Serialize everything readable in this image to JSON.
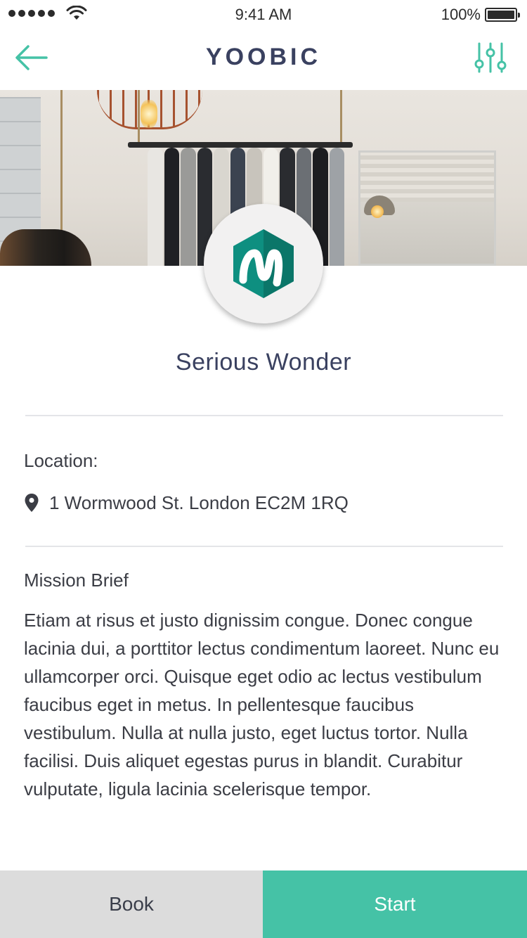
{
  "status_bar": {
    "time": "9:41 AM",
    "battery_percent": "100%",
    "signal_bars": 5
  },
  "nav": {
    "title": "YOOBIC",
    "back_icon": "arrow-left-icon",
    "filter_icon": "sliders-icon",
    "accent_color": "#45c2a6"
  },
  "store": {
    "name": "Serious Wonder",
    "logo_icon": "yoobic-m-logo"
  },
  "location": {
    "label": "Location:",
    "address": "1 Wormwood St. London EC2M 1RQ",
    "icon": "map-pin-icon"
  },
  "mission": {
    "label": "Mission Brief",
    "body": "Etiam at risus et justo dignissim congue. Donec congue lacinia dui, a porttitor lectus condimentum laoreet. Nunc eu ullamcorper orci. Quisque eget odio ac lectus vestibulum faucibus eget in metus. In pellentesque faucibus vestibulum. Nulla at nulla justo, eget luctus tortor. Nulla facilisi. Duis aliquet egestas purus in blandit. Curabitur vulputate, ligula lacinia scelerisque tempor."
  },
  "actions": {
    "book_label": "Book",
    "start_label": "Start",
    "start_color": "#45c2a6",
    "book_color": "#dcdcdc"
  }
}
